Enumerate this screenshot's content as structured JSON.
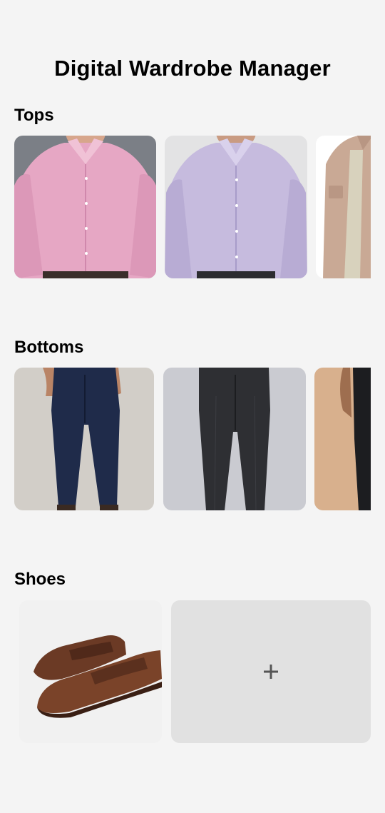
{
  "app": {
    "title": "Digital Wardrobe Manager"
  },
  "sections": {
    "tops": {
      "label": "Tops",
      "items": [
        {
          "name": "pink-dress-shirt",
          "color": "#e9a9c6"
        },
        {
          "name": "lavender-striped-shirt",
          "color": "#c4b8dc"
        },
        {
          "name": "beige-overshirt",
          "color": "#c9aa97"
        }
      ]
    },
    "bottoms": {
      "label": "Bottoms",
      "items": [
        {
          "name": "navy-trousers",
          "color": "#1e2a48"
        },
        {
          "name": "charcoal-trousers",
          "color": "#2f3034"
        },
        {
          "name": "black-trousers",
          "color": "#1b1c1e"
        }
      ]
    },
    "shoes": {
      "label": "Shoes",
      "items": [
        {
          "name": "brown-penny-loafers",
          "color": "#6a3a26"
        }
      ],
      "add_icon": "plus-icon"
    }
  }
}
